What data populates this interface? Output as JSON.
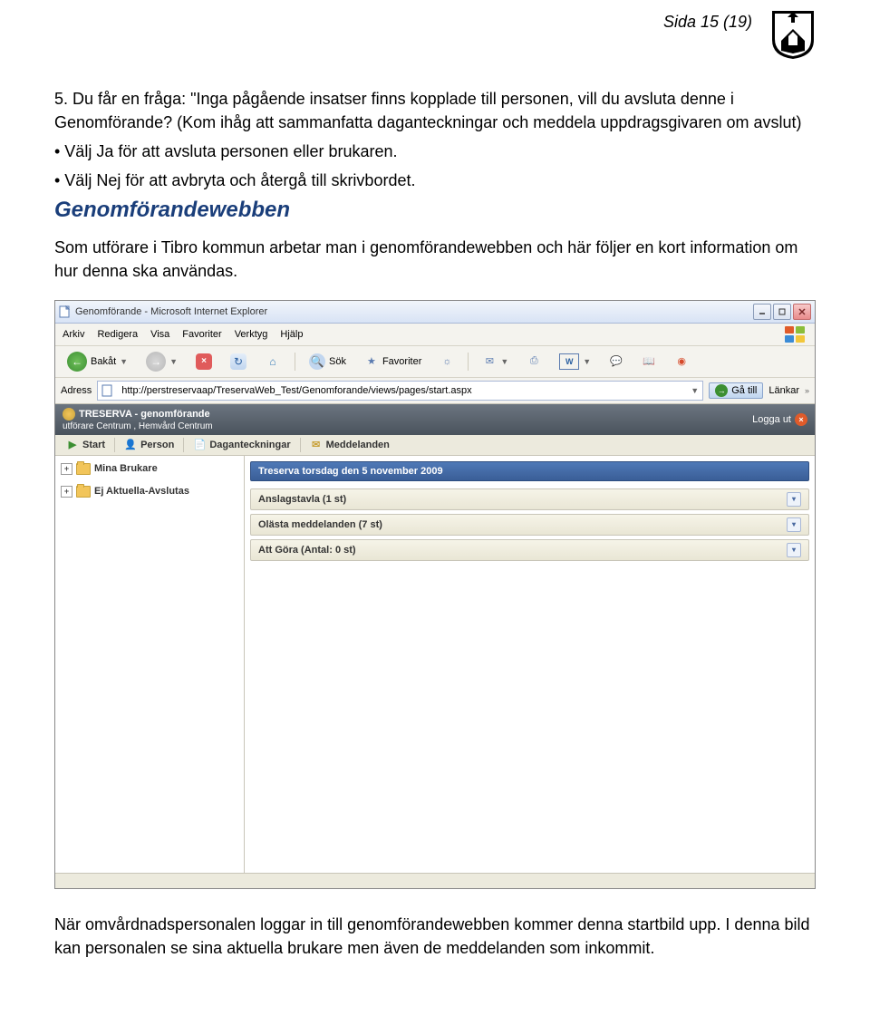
{
  "page_number": "Sida 15 (19)",
  "intro": {
    "line1": "5. Du får en fråga: \"Inga pågående insatser finns kopplade till personen, vill du avsluta denne i Genomförande? (Kom ihåg att sammanfatta daganteckningar och meddela uppdragsgivaren om avslut)",
    "bullet1": "• Välj Ja för att avsluta personen eller brukaren.",
    "bullet2": "• Välj Nej för att avbryta och återgå till skrivbordet.",
    "heading": "Genomförandewebben",
    "paragraph": "Som utförare i Tibro kommun arbetar man i genomförandewebben och här följer en kort information om hur denna ska användas."
  },
  "ie": {
    "title": "Genomförande - Microsoft Internet Explorer",
    "menus": [
      "Arkiv",
      "Redigera",
      "Visa",
      "Favoriter",
      "Verktyg",
      "Hjälp"
    ],
    "toolbar": {
      "back": "Bakåt",
      "search": "Sök",
      "favorites": "Favoriter"
    },
    "address_label": "Adress",
    "url": "http://perstreservaap/TreservaWeb_Test/Genomforande/views/pages/start.aspx",
    "go": "Gå till",
    "links": "Länkar"
  },
  "app": {
    "title": "TRESERVA - genomförande",
    "subtitle": "utförare Centrum , Hemvård Centrum",
    "logout": "Logga ut",
    "tabs": {
      "start": "Start",
      "person": "Person",
      "notes": "Daganteckningar",
      "messages": "Meddelanden"
    },
    "sidebar": {
      "item1": "Mina Brukare",
      "item2": "Ej Aktuella-Avslutas"
    },
    "main": {
      "date_banner": "Treserva torsdag den 5 november 2009",
      "rows": {
        "r1": "Anslagstavla (1 st)",
        "r2": "Olästa meddelanden (7 st)",
        "r3": "Att Göra (Antal: 0 st)"
      }
    }
  },
  "outro": "När omvårdnadspersonalen loggar in till genomförandewebben kommer denna startbild upp. I denna bild kan personalen se sina aktuella brukare men även de meddelanden som inkommit."
}
